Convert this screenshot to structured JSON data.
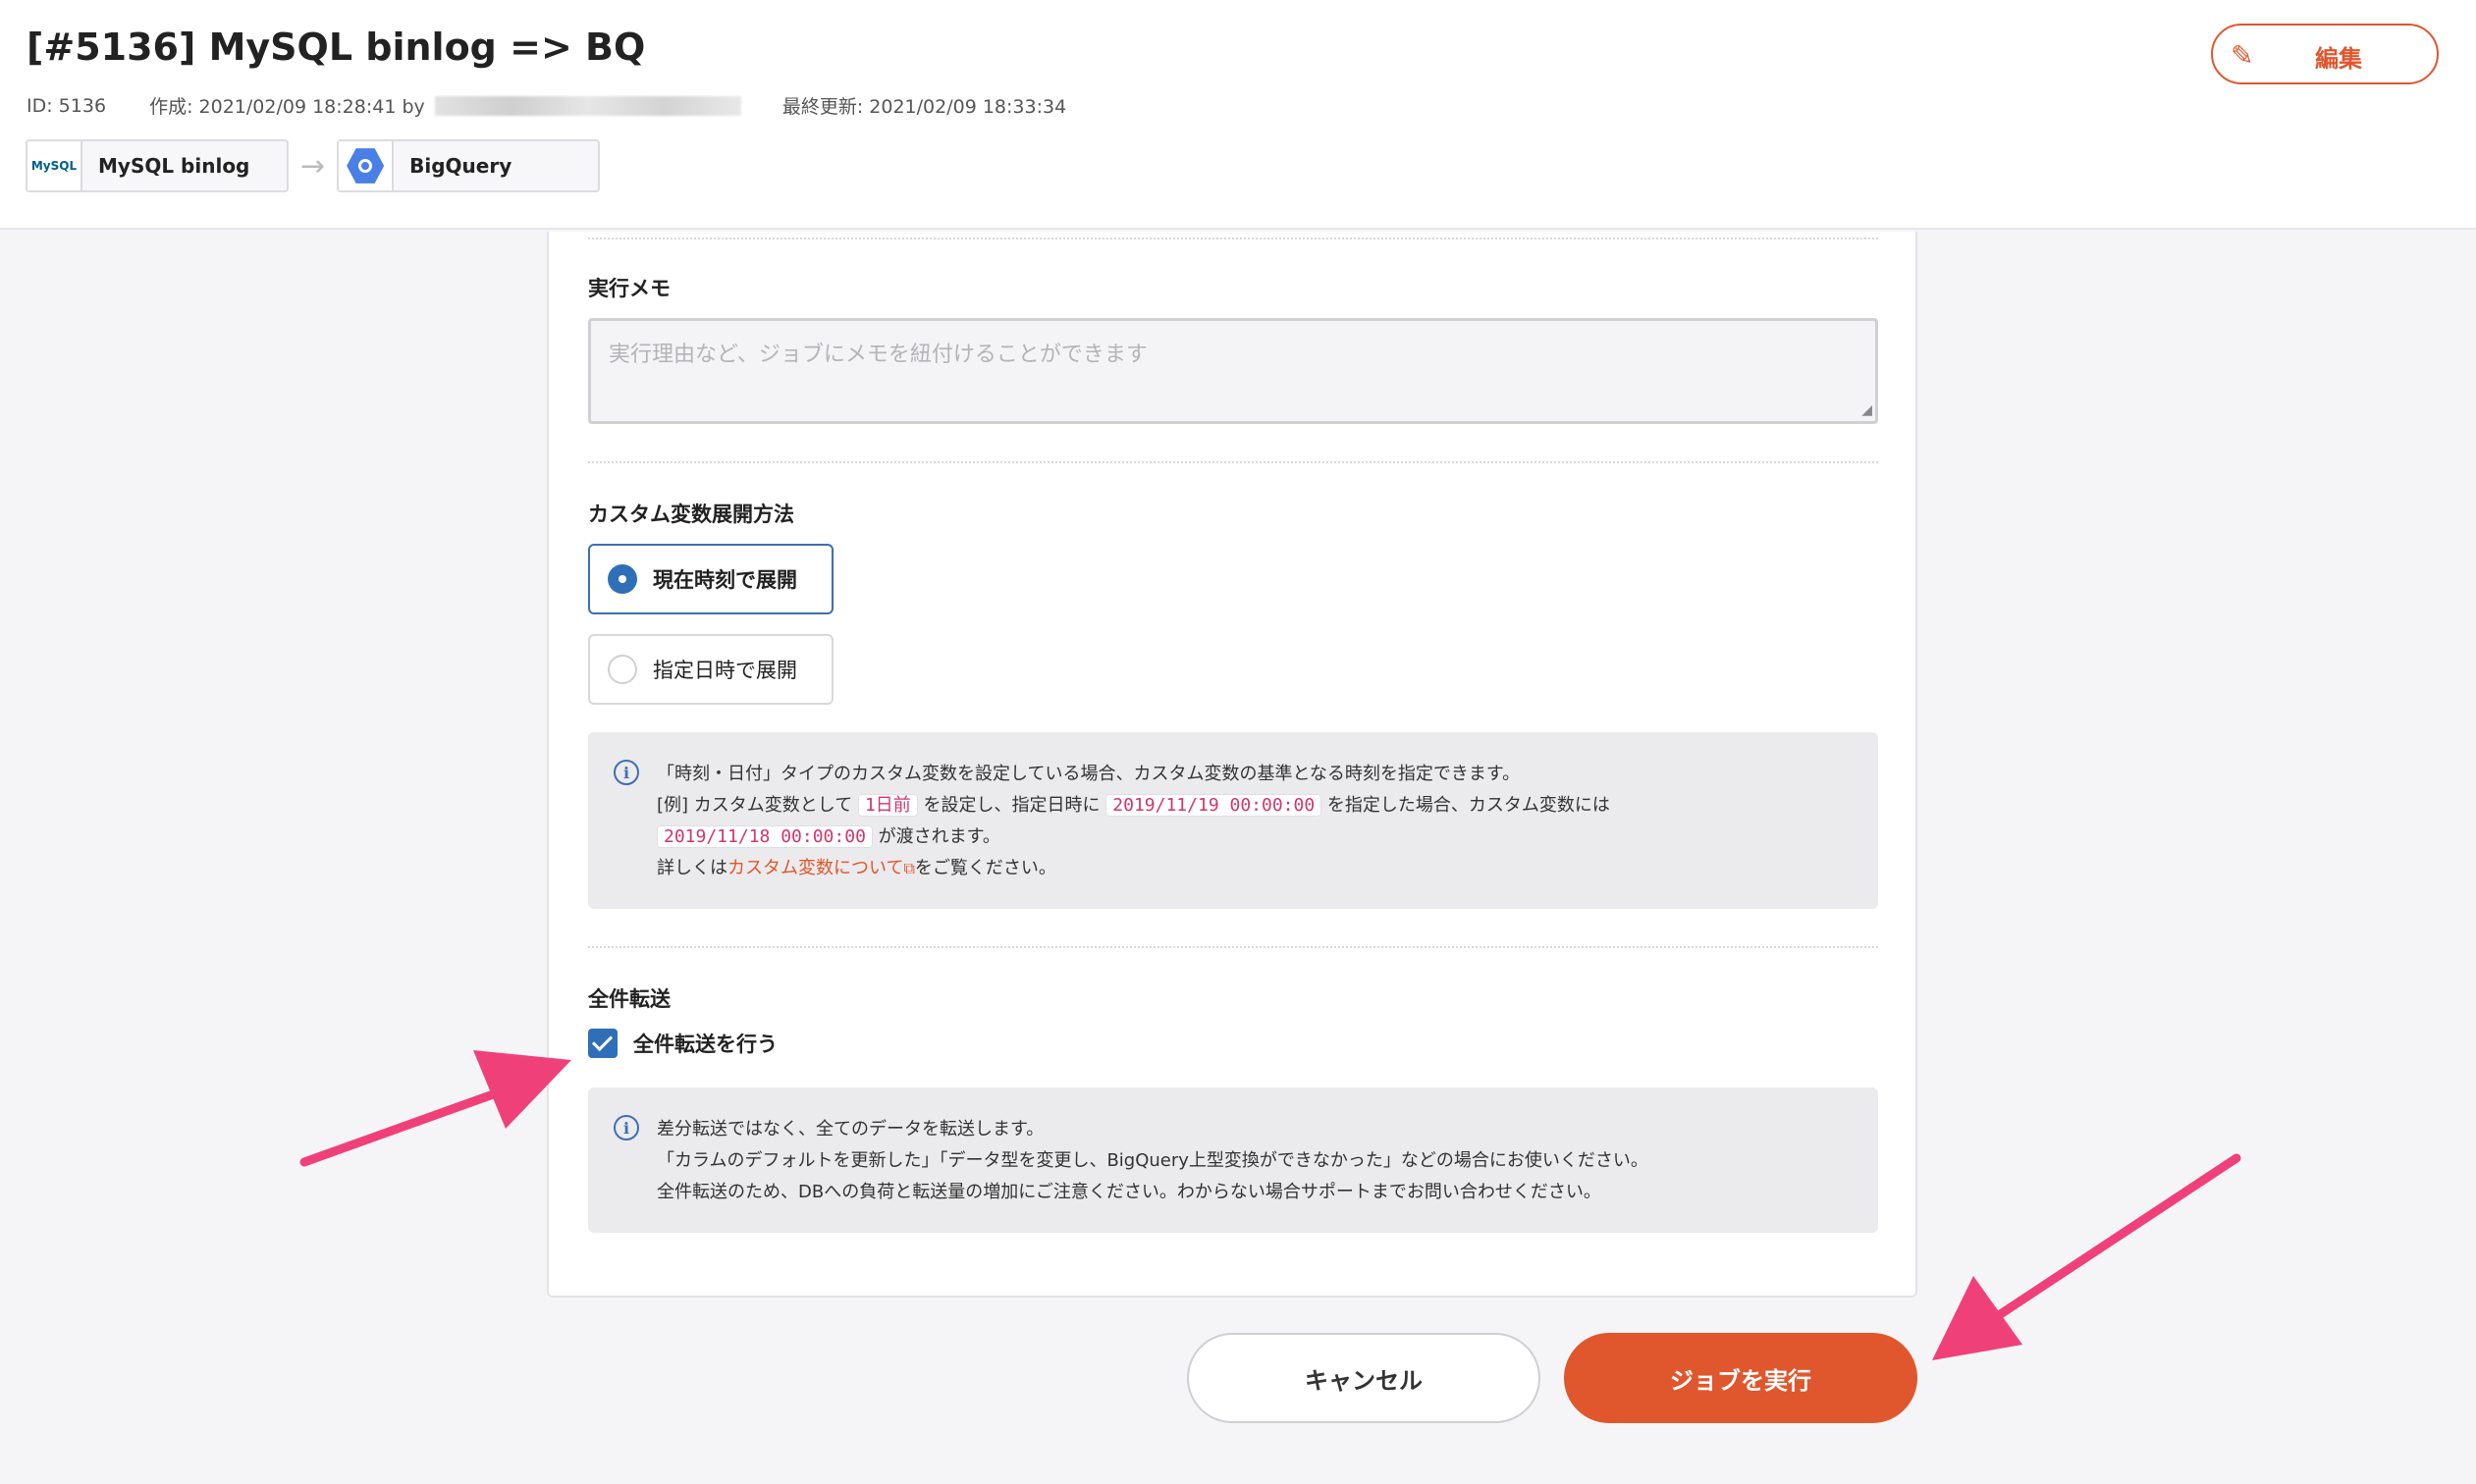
{
  "header": {
    "title": "[#5136] MySQL binlog => BQ",
    "id_text": "ID: 5136",
    "created_text": "作成: 2021/02/09 18:28:41 by",
    "updated_text": "最終更新: 2021/02/09 18:33:34",
    "edit_label": "編集",
    "source": {
      "label": "MySQL binlog",
      "icon_text": "MySQL"
    },
    "destination": {
      "label": "BigQuery"
    }
  },
  "memo": {
    "label": "実行メモ",
    "placeholder": "実行理由など、ジョブにメモを紐付けることができます"
  },
  "custom_var": {
    "label": "カスタム変数展開方法",
    "options": [
      {
        "label": "現在時刻で展開",
        "selected": true
      },
      {
        "label": "指定日時で展開",
        "selected": false
      }
    ],
    "info": {
      "line1": "「時刻・日付」タイプのカスタム変数を設定している場合、カスタム変数の基準となる時刻を指定できます。",
      "line2_a": "[例] カスタム変数として",
      "line2_code1": "1日前",
      "line2_b": "を設定し、指定日時に",
      "line2_code2": "2019/11/19 00:00:00",
      "line2_c": "を指定した場合、カスタム変数には",
      "line3_code": "2019/11/18 00:00:00",
      "line3_b": "が渡されます。",
      "line4_a": "詳しくは",
      "line4_link": "カスタム変数について",
      "line4_b": "をご覧ください。"
    }
  },
  "full_transfer": {
    "label": "全件転送",
    "checkbox_label": "全件転送を行う",
    "checked": true,
    "info": {
      "line1": "差分転送ではなく、全てのデータを転送します。",
      "line2": "「カラムのデフォルトを更新した」「データ型を変更し、BigQuery上型変換ができなかった」などの場合にお使いください。",
      "line3": "全件転送のため、DBへの負荷と転送量の増加にご注意ください。わからない場合サポートまでお問い合わせください。"
    }
  },
  "footer": {
    "cancel_label": "キャンセル",
    "run_label": "ジョブを実行"
  },
  "colors": {
    "accent": "#e0562d",
    "primary": "#2f6fb8",
    "annotation_arrow": "#f0407a"
  },
  "icons": [
    "pencil-icon",
    "mysql-logo-icon",
    "bigquery-icon",
    "arrow-right-icon",
    "info-icon",
    "external-link-icon",
    "checkmark-icon"
  ]
}
